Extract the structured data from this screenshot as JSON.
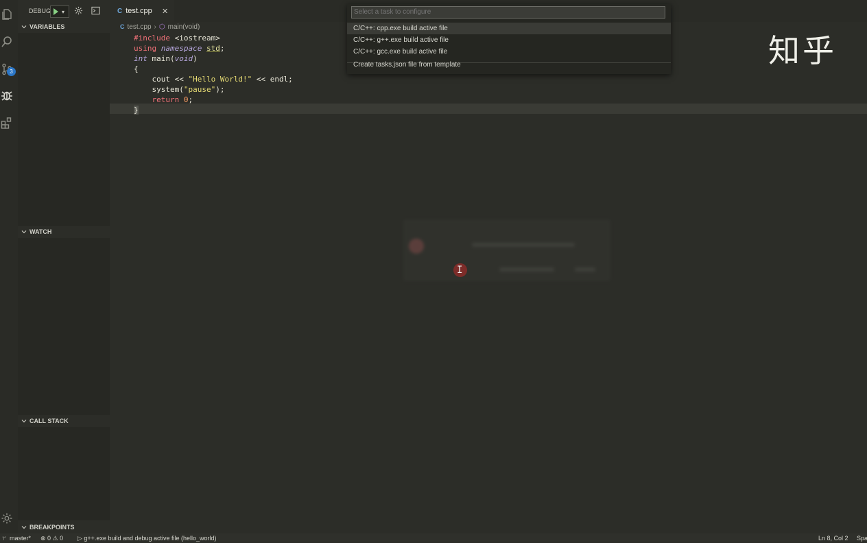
{
  "debug": {
    "label": "DEBUG",
    "run_dropdown": "▾"
  },
  "sections": {
    "variables": "VARIABLES",
    "watch": "WATCH",
    "call_stack": "CALL STACK",
    "breakpoints": "BREAKPOINTS"
  },
  "activity_bar": {
    "scm_badge": "3"
  },
  "tabs": [
    {
      "label": "test.cpp",
      "icon": "C"
    }
  ],
  "breadcrumb": {
    "file": "test.cpp",
    "symbol": "main(void)"
  },
  "code": [
    "#include <iostream>",
    "using namespace std;",
    "int main(void)",
    "{",
    "    cout << \"Hello World!\" << endl;",
    "    system(\"pause\");",
    "    return 0;",
    "}"
  ],
  "quick_pick": {
    "placeholder": "Select a task to configure",
    "items": [
      "C/C++: cpp.exe build active file",
      "C/C++: g++.exe build active file",
      "C/C++: gcc.exe build active file",
      "Create tasks.json file from template"
    ]
  },
  "watermark": "知乎",
  "status_bar": {
    "branch": "master*",
    "problems": "⊗ 0 ⚠ 0",
    "launch": "▷ g++.exe build and debug active file (hello_world)",
    "position": "Ln 8, Col 2",
    "spaces": "Spa"
  },
  "colors": {
    "background": "#2c2d28",
    "badge": "#2b76c6",
    "run": "#89d185"
  }
}
